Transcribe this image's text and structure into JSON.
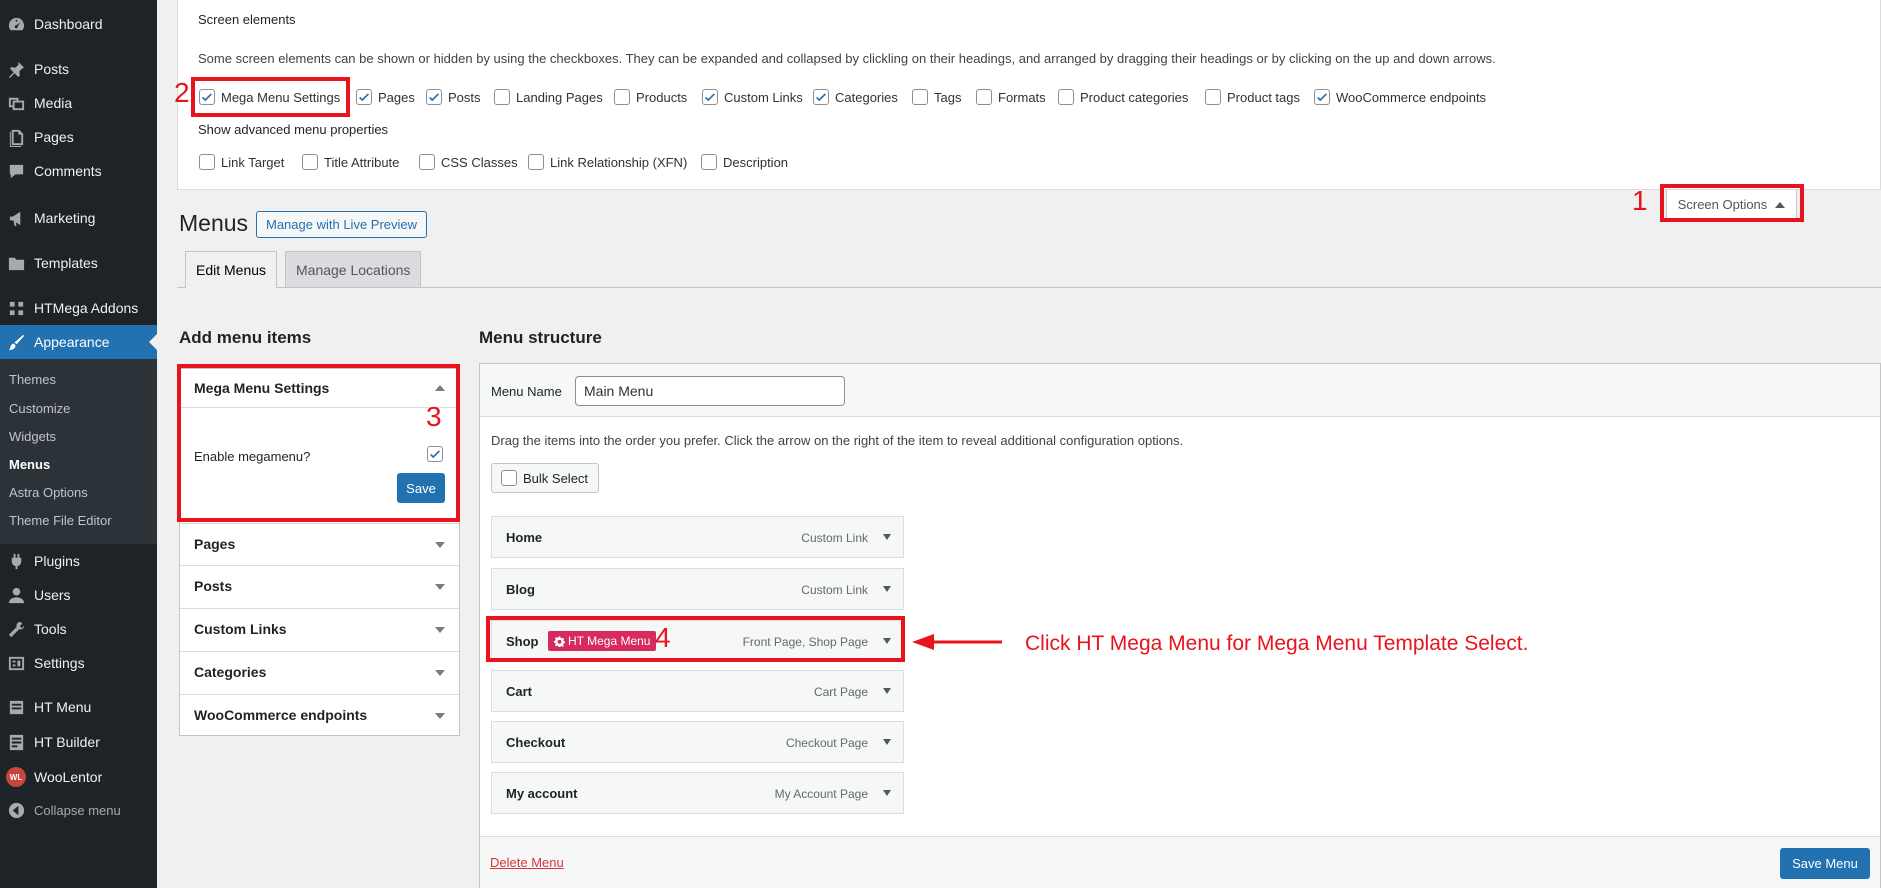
{
  "sidebar": {
    "items": [
      {
        "label": "Dashboard",
        "icon": "dashboard-icon"
      },
      {
        "label": "Posts",
        "icon": "pin-icon"
      },
      {
        "label": "Media",
        "icon": "media-icon"
      },
      {
        "label": "Pages",
        "icon": "page-icon"
      },
      {
        "label": "Comments",
        "icon": "comment-icon"
      },
      {
        "label": "Marketing",
        "icon": "megaphone-icon"
      },
      {
        "label": "Templates",
        "icon": "folder-icon"
      },
      {
        "label": "HTMega Addons",
        "icon": "htmega-icon"
      },
      {
        "label": "Appearance",
        "icon": "brush-icon"
      }
    ],
    "submenu": [
      "Themes",
      "Customize",
      "Widgets",
      "Menus",
      "Astra Options",
      "Theme File Editor"
    ],
    "bottom_items": [
      {
        "label": "Plugins",
        "icon": "plugin-icon"
      },
      {
        "label": "Users",
        "icon": "user-icon"
      },
      {
        "label": "Tools",
        "icon": "wrench-icon"
      },
      {
        "label": "Settings",
        "icon": "settings-icon"
      },
      {
        "label": "HT Menu",
        "icon": "menu-icon"
      },
      {
        "label": "HT Builder",
        "icon": "builder-icon"
      },
      {
        "label": "WooLentor",
        "icon": "woolentor-icon"
      },
      {
        "label": "Collapse menu",
        "icon": "collapse-icon"
      }
    ],
    "woo_badge": "WL"
  },
  "screen_options": {
    "title": "Screen elements",
    "description": "Some screen elements can be shown or hidden by using the checkboxes. They can be expanded and collapsed by clickling on their headings, and arranged by dragging their headings or by clicking on the up and down arrows.",
    "elements": [
      {
        "label": "Mega Menu Settings",
        "checked": true
      },
      {
        "label": "Pages",
        "checked": true
      },
      {
        "label": "Posts",
        "checked": true
      },
      {
        "label": "Landing Pages",
        "checked": false
      },
      {
        "label": "Products",
        "checked": false
      },
      {
        "label": "Custom Links",
        "checked": true
      },
      {
        "label": "Categories",
        "checked": true
      },
      {
        "label": "Tags",
        "checked": false
      },
      {
        "label": "Formats",
        "checked": false
      },
      {
        "label": "Product categories",
        "checked": false
      },
      {
        "label": "Product tags",
        "checked": false
      },
      {
        "label": "WooCommerce endpoints",
        "checked": true
      }
    ],
    "advanced_title": "Show advanced menu properties",
    "advanced": [
      {
        "label": "Link Target",
        "checked": false
      },
      {
        "label": "Title Attribute",
        "checked": false
      },
      {
        "label": "CSS Classes",
        "checked": false
      },
      {
        "label": "Link Relationship (XFN)",
        "checked": false
      },
      {
        "label": "Description",
        "checked": false
      }
    ],
    "button_label": "Screen Options"
  },
  "annotations": {
    "n1": "1",
    "n2": "2",
    "n3": "3",
    "n4": "4",
    "callout": "Click HT Mega Menu for Mega Menu Template Select."
  },
  "page": {
    "title": "Menus",
    "live_preview": "Manage with Live Preview",
    "tabs": [
      "Edit Menus",
      "Manage Locations"
    ]
  },
  "add_items": {
    "heading": "Add menu items",
    "mega": {
      "title": "Mega Menu Settings",
      "enable_label": "Enable megamenu?",
      "checked": true,
      "save": "Save"
    },
    "sections": [
      "Pages",
      "Posts",
      "Custom Links",
      "Categories",
      "WooCommerce endpoints"
    ]
  },
  "structure": {
    "heading": "Menu structure",
    "menu_name_label": "Menu Name",
    "menu_name_value": "Main Menu",
    "instructions": "Drag the items into the order you prefer. Click the arrow on the right of the item to reveal additional configuration options.",
    "bulk_select": "Bulk Select",
    "items": [
      {
        "name": "Home",
        "type": "Custom Link"
      },
      {
        "name": "Blog",
        "type": "Custom Link"
      },
      {
        "name": "Shop",
        "type": "Front Page, Shop Page",
        "badge": "HT Mega Menu"
      },
      {
        "name": "Cart",
        "type": "Cart Page"
      },
      {
        "name": "Checkout",
        "type": "Checkout Page"
      },
      {
        "name": "My account",
        "type": "My Account Page"
      }
    ],
    "delete": "Delete Menu",
    "save": "Save Menu"
  },
  "colors": {
    "accent": "#2271b1",
    "sidebar": "#1d2327",
    "annotation": "#e8141d",
    "badge": "#d72a5e"
  }
}
